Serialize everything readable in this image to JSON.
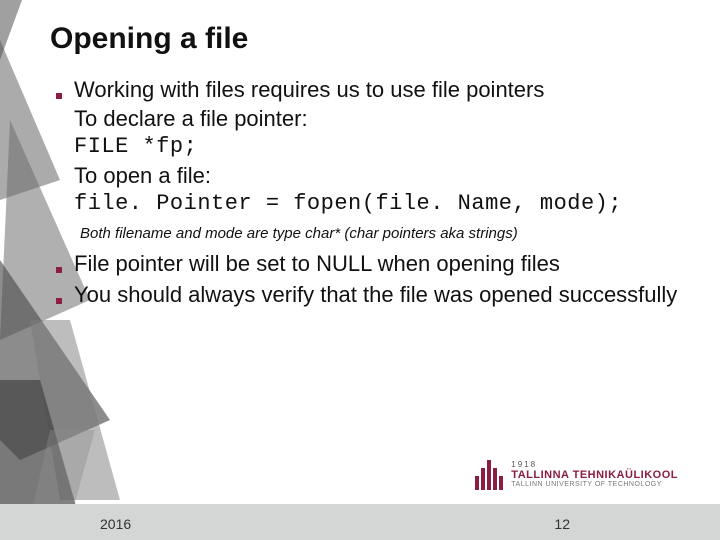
{
  "title": "Opening a file",
  "bullets": [
    {
      "lines": [
        {
          "text": "Working with files requires us to use file pointers",
          "mono": false
        },
        {
          "text": "To declare a file pointer:",
          "mono": false
        },
        {
          "text": "FILE *fp;",
          "mono": true
        },
        {
          "text": "To open a file:",
          "mono": false
        },
        {
          "text": "file. Pointer = fopen(file. Name, mode);",
          "mono": true
        }
      ]
    }
  ],
  "note": "Both filename and mode are type char* (char pointers aka strings)",
  "bullets2": [
    "File pointer will be set to NULL when opening files",
    "You should always verify that the file was opened successfully"
  ],
  "footer": {
    "year": "2016",
    "page": "12"
  },
  "logo": {
    "year": "1918",
    "main": "TALLINNA TEHNIKAÜLIKOOL",
    "sub": "TALLINN UNIVERSITY OF TECHNOLOGY"
  },
  "colors": {
    "accent": "#8b1d42",
    "footer_bg": "#d4d5d5"
  }
}
